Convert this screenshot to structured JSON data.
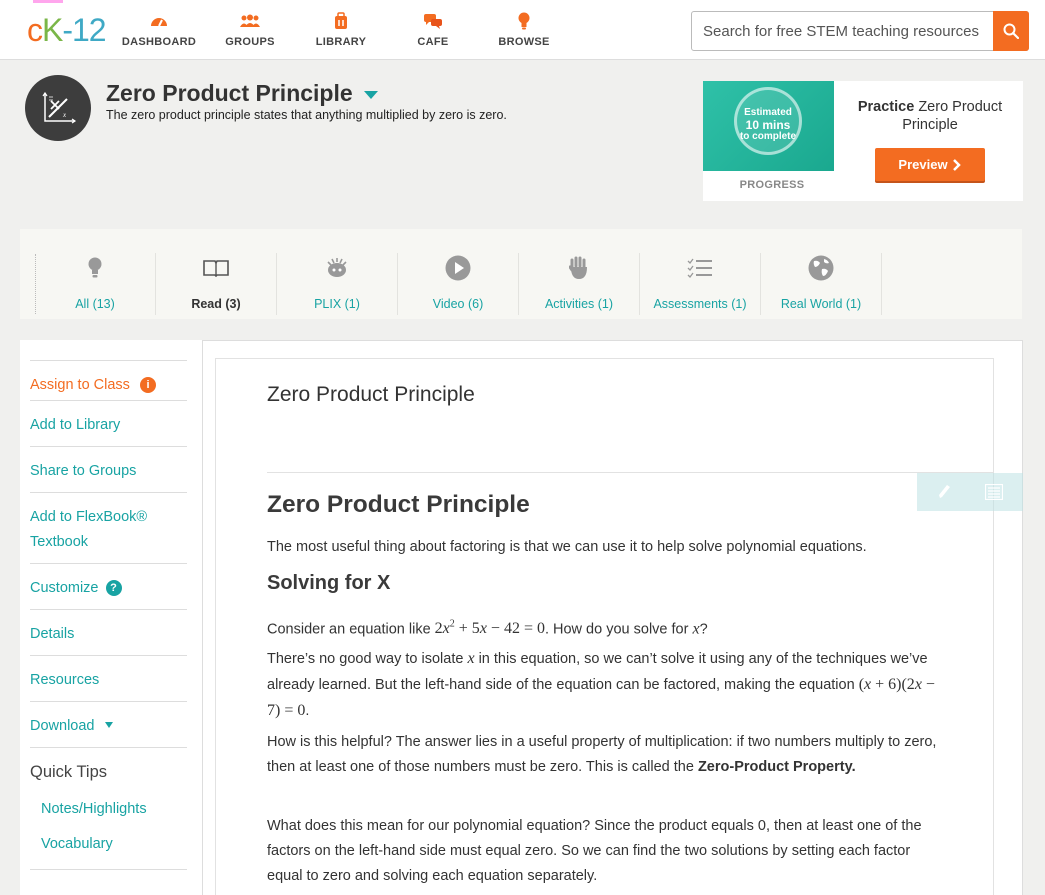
{
  "nav": {
    "logo_c": "c",
    "logo_k": "K",
    "logo_rest": "-12",
    "items": [
      {
        "label": "DASHBOARD",
        "icon": "dashboard-icon"
      },
      {
        "label": "GROUPS",
        "icon": "groups-icon"
      },
      {
        "label": "LIBRARY",
        "icon": "library-icon"
      },
      {
        "label": "CAFE",
        "icon": "cafe-icon"
      },
      {
        "label": "BROWSE",
        "icon": "browse-icon"
      }
    ],
    "search_placeholder": "Search for free STEM teaching resources"
  },
  "concept": {
    "title": "Zero Product Principle",
    "description": "The zero product principle states that anything multiplied by zero is zero."
  },
  "practice": {
    "estimate_line1": "Estimated",
    "estimate_line2": "10 mins",
    "estimate_line3": "to complete",
    "progress_label": "PROGRESS",
    "heading_bold": "Practice",
    "heading_rest": " Zero Product Principle",
    "button_label": "Preview"
  },
  "modalities": [
    {
      "label": "All (13)",
      "icon": "lightbulb-icon"
    },
    {
      "label": "Read (3)",
      "icon": "book-icon"
    },
    {
      "label": "PLIX (1)",
      "icon": "plix-icon"
    },
    {
      "label": "Video (6)",
      "icon": "play-icon"
    },
    {
      "label": "Activities (1)",
      "icon": "hand-icon"
    },
    {
      "label": "Assessments (1)",
      "icon": "checklist-icon"
    },
    {
      "label": "Real World (1)",
      "icon": "globe-icon"
    }
  ],
  "sidebar": {
    "assign": "Assign to Class",
    "add_library": "Add to Library",
    "share_groups": "Share to Groups",
    "add_flexbook_1": "Add to FlexBook®",
    "add_flexbook_2": "Textbook",
    "customize": "Customize",
    "details": "Details",
    "resources": "Resources",
    "download": "Download",
    "quick_tips": "Quick Tips",
    "notes": "Notes/Highlights",
    "vocabulary": "Vocabulary"
  },
  "article": {
    "page_title": "Zero Product Principle",
    "heading": "Zero Product Principle",
    "intro": "The most useful thing about factoring is that we can use it to help solve polynomial equations.",
    "subheading": "Solving for X",
    "p1_a": "Consider an equation like ",
    "p1_b": ". How do you solve for ",
    "p1_c": "?",
    "p2_a": "There’s no good way to isolate ",
    "p2_b": " in this equation, so we can’t solve it using any of the techniques we’ve already learned. But the left-hand side of the equation can be factored, making the equation ",
    "p2_c": ".",
    "p3_a": "How is this helpful? The answer lies in a useful property of multiplication: if two numbers multiply to zero, then at least one of those numbers must be zero. This is called the ",
    "p3_b": "Zero-Product Property.",
    "p4": "What does this mean for our polynomial equation? Since the product equals 0, then at least one of the factors on the left-hand side must equal zero. So we can find the two solutions by setting each factor equal to zero and solving each equation separately."
  },
  "colors": {
    "brand_orange": "#f36c21",
    "brand_teal": "#18a3a3",
    "logo_green": "#7ab648"
  }
}
